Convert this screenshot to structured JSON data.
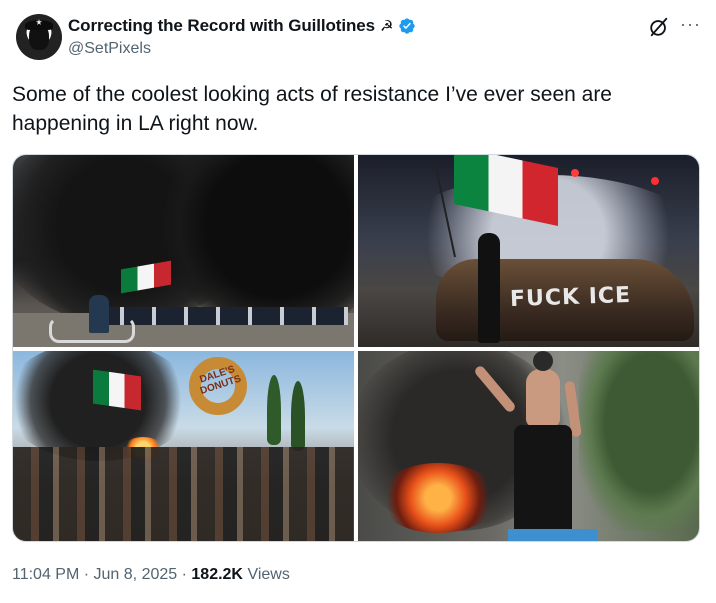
{
  "author": {
    "display_name": "Correcting the Record with Guillotines",
    "name_emoji": "☭",
    "handle": "@SetPixels",
    "verified": true
  },
  "actions": {
    "grok_icon": "grok-icon",
    "more_label": "···"
  },
  "tweet": {
    "text": "Some of the coolest looking acts of resistance I’ve ever seen are happening in LA right now."
  },
  "media": {
    "photos": [
      {
        "id": "photo-1",
        "car_text": ""
      },
      {
        "id": "photo-2",
        "car_text": "FUCK ICE"
      },
      {
        "id": "photo-3",
        "sign_text": "DALE'S DONUTS"
      },
      {
        "id": "photo-4"
      }
    ]
  },
  "meta": {
    "time": "11:04 PM",
    "separator": "·",
    "date": "Jun 8, 2025",
    "views_count": "182.2K",
    "views_label": "Views"
  },
  "colors": {
    "text": "#0f1419",
    "secondary": "#536471",
    "verified_blue": "#1d9bf0",
    "border": "#cfd9de"
  }
}
